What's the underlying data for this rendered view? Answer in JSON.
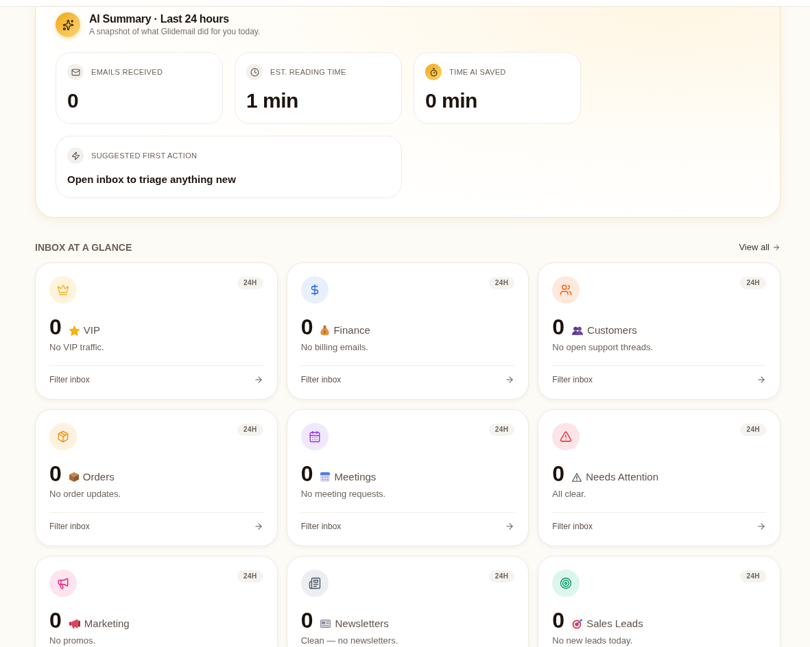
{
  "summary": {
    "title": "AI Summary · Last 24 hours",
    "subtitle": "A snapshot of what Glidemail did for you today.",
    "stats": [
      {
        "kind": "emails",
        "label": "EMAILS RECEIVED",
        "value": "0"
      },
      {
        "kind": "reading",
        "label": "EST. READING TIME",
        "value": "1 min"
      },
      {
        "kind": "saved",
        "label": "TIME AI SAVED",
        "value": "0 min"
      }
    ],
    "suggested_action": {
      "kind": "action",
      "label": "SUGGESTED FIRST ACTION",
      "text": "Open inbox to triage anything new"
    }
  },
  "inbox": {
    "title": "INBOX AT A GLANCE",
    "view_all": "View all",
    "cards": [
      {
        "kind": "vip",
        "badge": "24H",
        "count": "0",
        "label": "VIP",
        "description": "No VIP traffic.",
        "action": "Filter inbox"
      },
      {
        "kind": "finance",
        "badge": "24H",
        "count": "0",
        "label": "Finance",
        "description": "No billing emails.",
        "action": "Filter inbox"
      },
      {
        "kind": "customers",
        "badge": "24H",
        "count": "0",
        "label": "Customers",
        "description": "No open support threads.",
        "action": "Filter inbox"
      },
      {
        "kind": "orders",
        "badge": "24H",
        "count": "0",
        "label": "Orders",
        "description": "No order updates.",
        "action": "Filter inbox"
      },
      {
        "kind": "meetings",
        "badge": "24H",
        "count": "0",
        "label": "Meetings",
        "description": "No meeting requests.",
        "action": "Filter inbox"
      },
      {
        "kind": "attention",
        "badge": "24H",
        "count": "0",
        "label": "Needs Attention",
        "description": "All clear.",
        "action": "Filter inbox"
      },
      {
        "kind": "marketing",
        "badge": "24H",
        "count": "0",
        "label": "Marketing",
        "description": "No promos."
      },
      {
        "kind": "newsletters",
        "badge": "24H",
        "count": "0",
        "label": "Newsletters",
        "description": "Clean — no newsletters."
      },
      {
        "kind": "leads",
        "badge": "24H",
        "count": "0",
        "label": "Sales Leads",
        "description": "No new leads today."
      }
    ]
  }
}
